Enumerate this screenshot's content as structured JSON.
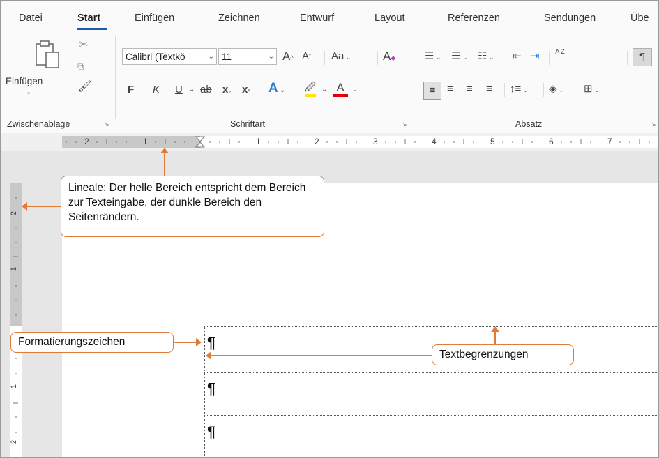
{
  "tabs": [
    {
      "label": "Datei",
      "active": false
    },
    {
      "label": "Start",
      "active": true
    },
    {
      "label": "Einfügen",
      "active": false
    },
    {
      "label": "Zeichnen",
      "active": false
    },
    {
      "label": "Entwurf",
      "active": false
    },
    {
      "label": "Layout",
      "active": false
    },
    {
      "label": "Referenzen",
      "active": false
    },
    {
      "label": "Sendungen",
      "active": false
    },
    {
      "label": "Übe",
      "active": false
    }
  ],
  "ribbon": {
    "clipboard": {
      "paste_label": "Einfügen",
      "group_label": "Zwischenablage"
    },
    "font": {
      "font_name": "Calibri (Textkö",
      "font_size": "11",
      "bold": "F",
      "italic": "K",
      "underline": "U",
      "strike": "ab",
      "subscript": "x",
      "superscript": "x",
      "grow": "A",
      "shrink": "A",
      "case": "Aa",
      "clear": "A",
      "effects": "A",
      "highlight": "🖉",
      "color": "A",
      "group_label": "Schriftart"
    },
    "paragraph": {
      "group_label": "Absatz",
      "pilcrow": "¶",
      "sort": "A Z"
    }
  },
  "ruler": {
    "h_labels_left": [
      "2",
      "1"
    ],
    "h_labels_right": [
      "1",
      "2",
      "3",
      "4",
      "5",
      "6",
      "7"
    ],
    "v_labels": [
      "2",
      "1",
      "1",
      "2"
    ]
  },
  "document": {
    "pilcrows": [
      "¶",
      "¶",
      "¶"
    ]
  },
  "callouts": {
    "rulers": "Lineale: Der helle Bereich entspricht dem Bereich zur Texteingabe, der dunkle Bereich den Seitenrändern.",
    "format_marks": "Formatierungszeichen",
    "text_bounds": "Textbegrenzungen"
  },
  "colors": {
    "accent": "#1f5aa8",
    "callout": "#e07a3a",
    "highlight": "#ffe600",
    "font_color": "#e00000"
  }
}
